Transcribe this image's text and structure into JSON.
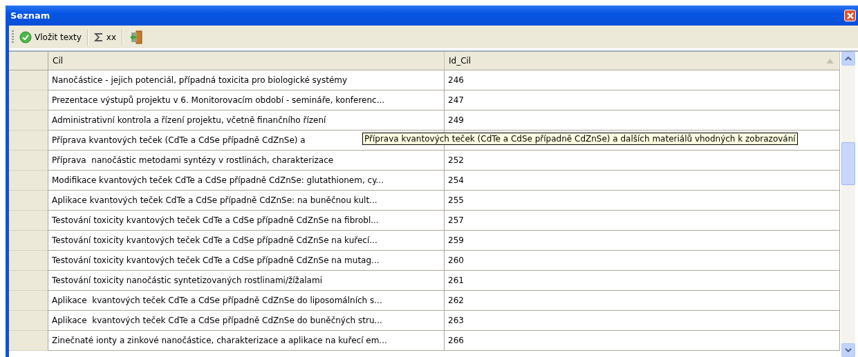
{
  "window": {
    "title": "Seznam"
  },
  "toolbar": [
    {
      "kind": "check",
      "label": "Vložit texty"
    },
    {
      "kind": "sigma",
      "label": "xx"
    },
    {
      "kind": "exit"
    }
  ],
  "table": {
    "columns": [
      {
        "label": "Cil",
        "sorted": false
      },
      {
        "label": "Id_Cil",
        "sorted": true
      }
    ],
    "rows": [
      {
        "cil": "Nanočástice - jejich potenciál, případná toxicita pro biologické systémy",
        "id": "246"
      },
      {
        "cil": "Prezentace výstupů projektu v 6. Monitorovacím období - semináře, konferenc...",
        "id": "247"
      },
      {
        "cil": "Administrativní kontrola a řízení projektu, včetně finančního řízení",
        "id": "249"
      },
      {
        "cil": "Příprava kvantových teček (CdTe a CdSe případně CdZnSe) a",
        "tooltip": "Příprava kvantových teček (CdTe a CdSe případně CdZnSe) a dalších materiálů vhodných k zobrazování"
      },
      {
        "cil": "Příprava  nanočástic metodami syntézy v rostlinách, charakterizace",
        "id": "252"
      },
      {
        "cil": "Modifikace kvantových teček CdTe a CdSe případně CdZnSe: glutathionem, cy...",
        "id": "254"
      },
      {
        "cil": "Aplikace kvantových teček CdTe a CdSe případně CdZnSe: na buněčnou kult...",
        "id": "255"
      },
      {
        "cil": "Testování toxicity kvantových teček CdTe a CdSe případně CdZnSe na fibrobl...",
        "id": "257"
      },
      {
        "cil": "Testování toxicity kvantových teček CdTe a CdSe případně CdZnSe na kuřecí...",
        "id": "259"
      },
      {
        "cil": "Testování toxicity kvantových teček CdTe a CdSe případně CdZnSe na mutag...",
        "id": "260"
      },
      {
        "cil": "Testování toxicity nanočástic syntetizovaných rostlinami/žížalami",
        "id": "261"
      },
      {
        "cil": "Aplikace  kvantových teček CdTe a CdSe případně CdZnSe do liposomálních s...",
        "id": "262"
      },
      {
        "cil": "Aplikace  kvantových teček CdTe a CdSe případně CdZnSe do buněčných stru...",
        "id": "263"
      },
      {
        "cil": "Zinečnaté ionty a zinkové nanočástice, charakterizace a aplikace na kuřecí em...",
        "id": "266"
      }
    ]
  }
}
